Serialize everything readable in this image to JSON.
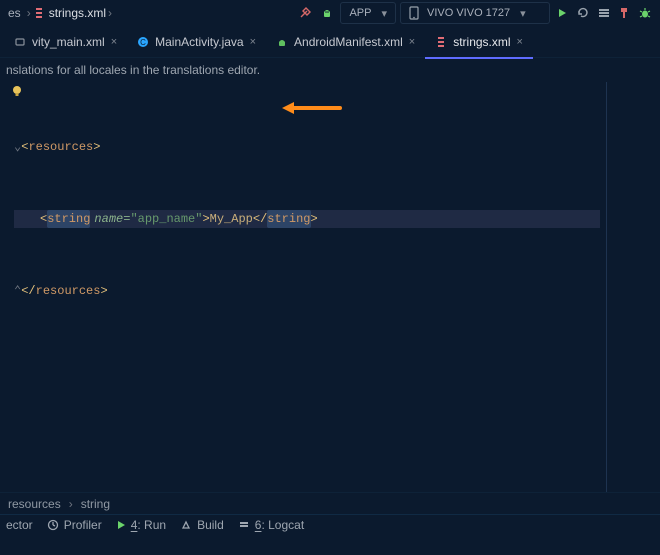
{
  "breadcrumbTop": {
    "left": "es",
    "file": "strings.xml"
  },
  "toolbar": {
    "module": "APP",
    "device": "VIVO VIVO 1727"
  },
  "tabs": [
    {
      "label": "vity_main.xml",
      "iconColor": "clip"
    },
    {
      "label": "MainActivity.java",
      "iconColor": "java"
    },
    {
      "label": "AndroidManifest.xml",
      "iconColor": "andr"
    },
    {
      "label": "strings.xml",
      "iconColor": "xml"
    }
  ],
  "banner": "nslations for all locales in the translations editor.",
  "code": {
    "tag_resources": "resources",
    "tag_string": "string",
    "attr_name_key": "name",
    "attr_name_val": "app_name",
    "value": "My_App"
  },
  "breadcrumbBottom": {
    "lvl1": "resources",
    "lvl2": "string"
  },
  "bottom": {
    "inspector": "ector",
    "profiler": "Profiler",
    "run_prefix": "4",
    "run_label": ": Run",
    "build": "Build",
    "logcat_prefix": "6",
    "logcat_label": ": Logcat"
  }
}
